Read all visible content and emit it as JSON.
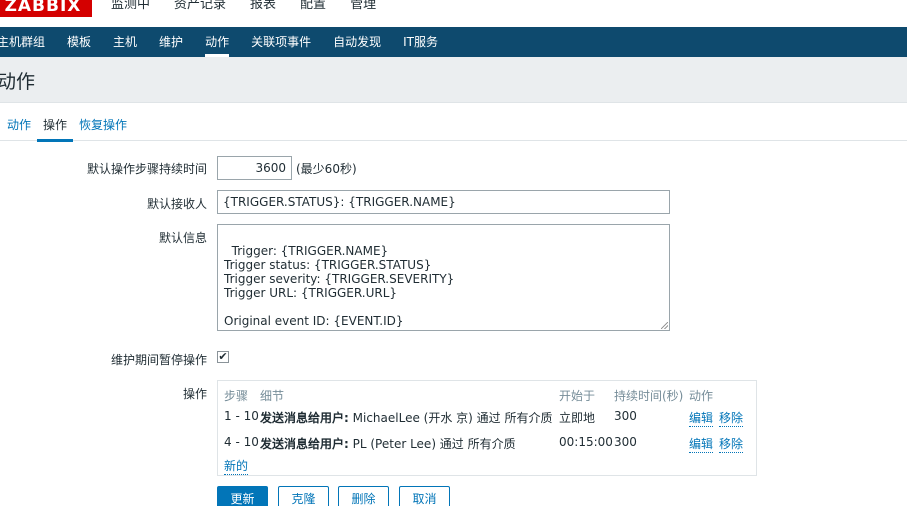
{
  "brand": {
    "logo": "ZABBIX"
  },
  "top_menu": [
    "监测中",
    "资产记录",
    "报表",
    "配置",
    "管理"
  ],
  "sub_nav": [
    "主机群组",
    "模板",
    "主机",
    "维护",
    "动作",
    "关联项事件",
    "自动发现",
    "IT服务"
  ],
  "page": {
    "title": "动作"
  },
  "tabs": [
    "动作",
    "操作",
    "恢复操作"
  ],
  "form": {
    "step_duration_label": "默认操作步骤持续时间",
    "step_duration_value": "3600",
    "step_duration_hint": "(最少60秒)",
    "recipient_label": "默认接收人",
    "recipient_value": "{TRIGGER.STATUS}: {TRIGGER.NAME}",
    "message_label": "默认信息",
    "message_value": "Trigger: {TRIGGER.NAME}\nTrigger status: {TRIGGER.STATUS}\nTrigger severity: {TRIGGER.SEVERITY}\nTrigger URL: {TRIGGER.URL}\n\nOriginal event ID: {EVENT.ID}",
    "pause_label": "维护期间暂停操作",
    "pause_checked": true,
    "operations_label": "操作"
  },
  "operations": {
    "headers": {
      "steps": "步骤",
      "details": "细节",
      "start_in": "开始于",
      "duration": "持续时间(秒)",
      "action": "动作"
    },
    "rows": [
      {
        "steps": "1 - 10",
        "detail_bold": "发送消息给用户:",
        "detail_rest": " MichaelLee (开水 京) 通过 所有介质",
        "start_in": "立即地",
        "duration": "300",
        "edit": "编辑",
        "remove": "移除"
      },
      {
        "steps": "4 - 10",
        "detail_bold": "发送消息给用户:",
        "detail_rest": " PL (Peter Lee) 通过 所有介质",
        "start_in": "00:15:00",
        "duration": "300",
        "edit": "编辑",
        "remove": "移除"
      }
    ],
    "new_link": "新的"
  },
  "buttons": {
    "update": "更新",
    "clone": "克隆",
    "delete": "删除",
    "cancel": "取消"
  },
  "colors": {
    "nav_bg": "#0e4a6e",
    "accent": "#0275b8",
    "brand_red": "#d40000"
  }
}
